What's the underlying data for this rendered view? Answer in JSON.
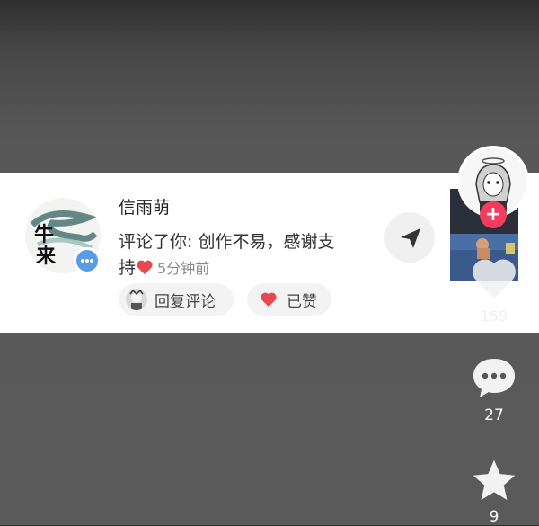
{
  "notification": {
    "username": "信雨萌",
    "comment_line1": "评论了你: 创作不易，感谢支",
    "comment_line2": "持",
    "time": "5分钟前",
    "reply_label": "回复评论",
    "liked_label": "已赞"
  },
  "sidebar": {
    "like_count": "159",
    "comment_count": "27",
    "favorite_count": "9"
  },
  "colors": {
    "follow": "#f23d5f",
    "heart": "#e8484f",
    "comment_badge": "#5a9be6"
  }
}
